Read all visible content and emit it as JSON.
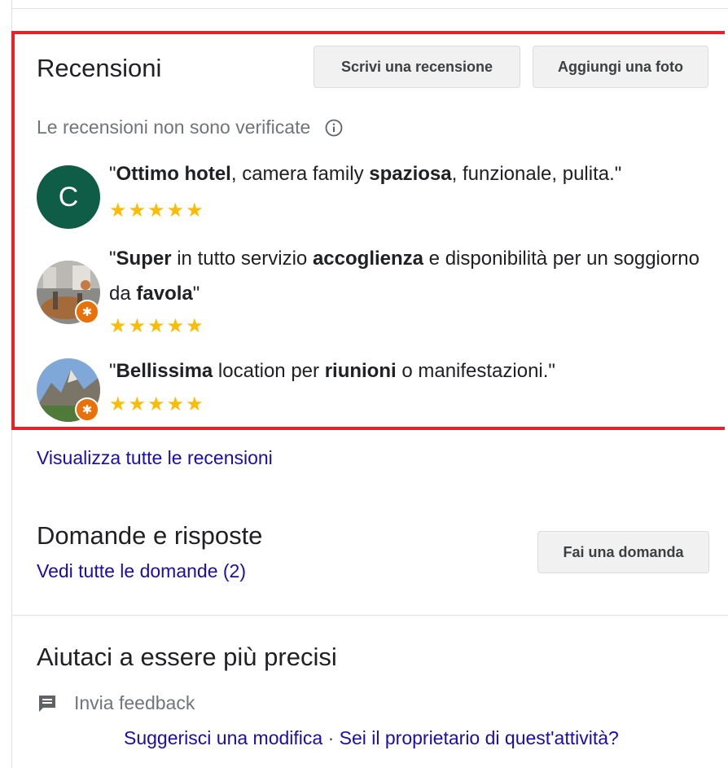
{
  "reviews": {
    "title": "Recensioni",
    "write_button": "Scrivi una recensione",
    "photo_button": "Aggiungi una foto",
    "unverified_note": "Le recensioni non sono verificate",
    "items": [
      {
        "avatar_letter": "C",
        "avatar_color": "#0f5c47",
        "parts": [
          {
            "t": "\"",
            "b": false
          },
          {
            "t": "Ottimo hotel",
            "b": true
          },
          {
            "t": ", camera family ",
            "b": false
          },
          {
            "t": "spaziosa",
            "b": true
          },
          {
            "t": ", funzionale, pulita.\"",
            "b": false
          }
        ],
        "rating": 5
      },
      {
        "avatar_letter": "",
        "avatar_icon": "photo-avatar-interior",
        "local_guide": true,
        "parts": [
          {
            "t": "\"",
            "b": false
          },
          {
            "t": "Super",
            "b": true
          },
          {
            "t": " in tutto servizio ",
            "b": false
          },
          {
            "t": "accoglienza",
            "b": true
          },
          {
            "t": " e disponibilità per un soggiorno da ",
            "b": false
          },
          {
            "t": "favola",
            "b": true
          },
          {
            "t": "\"",
            "b": false
          }
        ],
        "rating": 5
      },
      {
        "avatar_letter": "",
        "avatar_icon": "photo-avatar-mountain",
        "local_guide": true,
        "parts": [
          {
            "t": "\"",
            "b": false
          },
          {
            "t": "Bellissima",
            "b": true
          },
          {
            "t": " location per ",
            "b": false
          },
          {
            "t": "riunioni",
            "b": true
          },
          {
            "t": " o manifestazioni.\"",
            "b": false
          }
        ],
        "rating": 5
      }
    ],
    "view_all_link": "Visualizza tutte le recensioni"
  },
  "qa": {
    "title": "Domande e risposte",
    "link": "Vedi tutte le domande (2)",
    "ask_button": "Fai una domanda"
  },
  "help": {
    "title": "Aiutaci a essere più precisi",
    "feedback": "Invia feedback",
    "suggest_edit": "Suggerisci una modifica",
    "separator": " · ",
    "owner_link": "Sei il proprietario di quest'attività?"
  },
  "colors": {
    "highlight_border": "#e8212a",
    "star": "#fbbc04",
    "link": "#1a0dab",
    "local_guide_badge": "#e8710a"
  }
}
